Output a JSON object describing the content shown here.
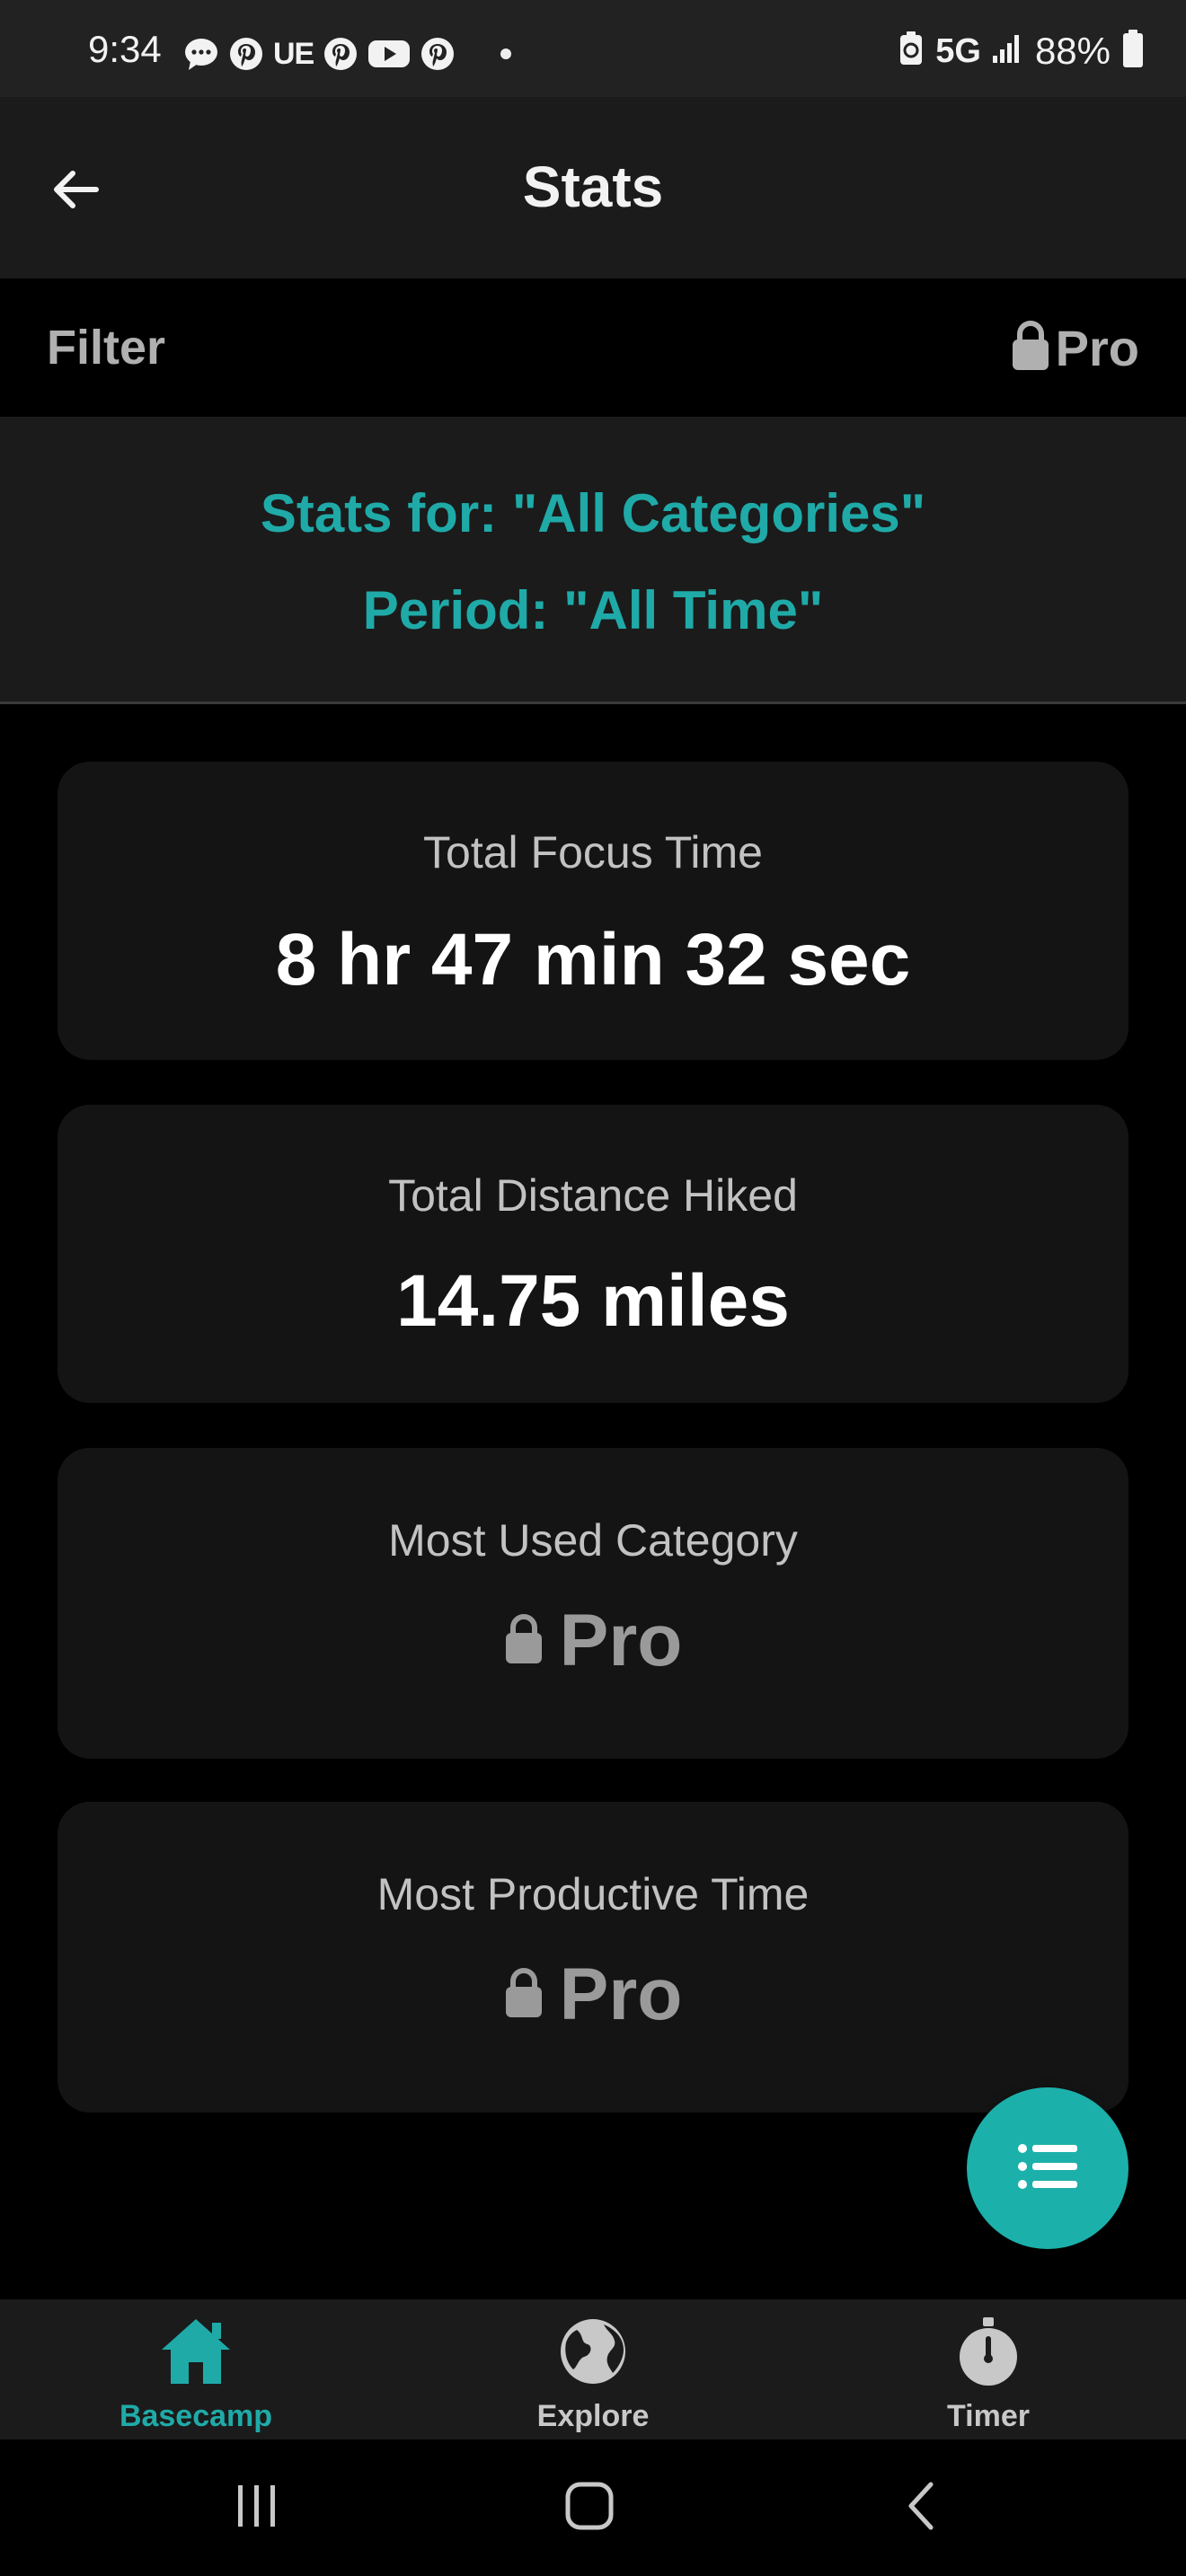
{
  "status_bar": {
    "time": "9:34",
    "notification_icons": [
      "chat-bubble-icon",
      "pinterest-icon",
      "uber-eats-icon",
      "pinterest-icon",
      "youtube-icon",
      "pinterest-icon",
      "more-dot-icon"
    ],
    "ue_text": "UE",
    "network": "5G",
    "battery_percent": "88%"
  },
  "app_bar": {
    "title": "Stats",
    "back_icon": "arrow-left-icon"
  },
  "filter_row": {
    "label": "Filter",
    "pro_label": "Pro",
    "lock_icon": "lock-icon"
  },
  "stats_header": {
    "stats_for": "Stats for: \"All Categories\"",
    "period": "Period: \"All Time\""
  },
  "cards": [
    {
      "label": "Total Focus Time",
      "value": "8 hr 47 min 32 sec"
    },
    {
      "label": "Total Distance Hiked",
      "value": "14.75 miles"
    },
    {
      "label": "Most Used Category",
      "value": "Pro",
      "locked": true
    },
    {
      "label": "Most Productive Time",
      "value": "Pro",
      "locked": true
    }
  ],
  "fab": {
    "icon": "list-icon"
  },
  "bottom_nav": {
    "items": [
      {
        "label": "Basecamp",
        "icon": "home-icon",
        "active": true
      },
      {
        "label": "Explore",
        "icon": "globe-icon",
        "active": false
      },
      {
        "label": "Timer",
        "icon": "stopwatch-icon",
        "active": false
      }
    ]
  },
  "system_nav": {
    "buttons": [
      "recents-icon",
      "home-button-icon",
      "back-chevron-icon"
    ]
  },
  "colors": {
    "accent": "#1faaa8",
    "fab": "#1cb0ab",
    "background": "#000000",
    "surface": "#1b1b1b",
    "card": "#141414",
    "muted_text": "#b0b0b0"
  }
}
